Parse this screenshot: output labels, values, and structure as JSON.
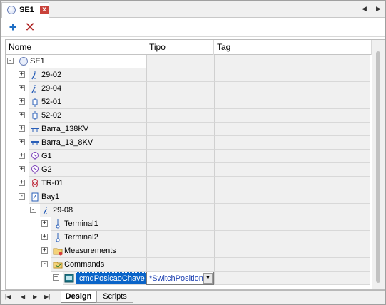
{
  "window": {
    "tab_title": "SE1",
    "close_glyph": "x",
    "nav_left": "◀",
    "nav_right": "▶"
  },
  "toolbar": {
    "add_glyph": "+",
    "delete_glyph": "✕"
  },
  "grid": {
    "columns": [
      "Nome",
      "Tipo",
      "Tag"
    ],
    "rows": [
      {
        "label": "SE1",
        "level": 0,
        "expander": "-",
        "icon": "substation-circle-icon"
      },
      {
        "label": "29-02",
        "level": 1,
        "expander": "+",
        "icon": "disconnector-icon"
      },
      {
        "label": "29-04",
        "level": 1,
        "expander": "+",
        "icon": "disconnector-icon"
      },
      {
        "label": "52-01",
        "level": 1,
        "expander": "+",
        "icon": "breaker-icon"
      },
      {
        "label": "52-02",
        "level": 1,
        "expander": "+",
        "icon": "breaker-icon"
      },
      {
        "label": "Barra_138KV",
        "level": 1,
        "expander": "+",
        "icon": "busbar-icon"
      },
      {
        "label": "Barra_13_8KV",
        "level": 1,
        "expander": "+",
        "icon": "busbar-icon"
      },
      {
        "label": "G1",
        "level": 1,
        "expander": "+",
        "icon": "generator-icon"
      },
      {
        "label": "G2",
        "level": 1,
        "expander": "+",
        "icon": "generator-icon"
      },
      {
        "label": "TR-01",
        "level": 1,
        "expander": "+",
        "icon": "transformer-icon"
      },
      {
        "label": "Bay1",
        "level": 1,
        "expander": "-",
        "icon": "bay-icon"
      },
      {
        "label": "29-08",
        "level": 2,
        "expander": "-",
        "icon": "disconnector-icon"
      },
      {
        "label": "Terminal1",
        "level": 3,
        "expander": "+",
        "icon": "terminal-icon"
      },
      {
        "label": "Terminal2",
        "level": 3,
        "expander": "+",
        "icon": "terminal-icon"
      },
      {
        "label": "Measurements",
        "level": 3,
        "expander": "+",
        "icon": "measurements-folder-icon"
      },
      {
        "label": "Commands",
        "level": 3,
        "expander": "-",
        "icon": "commands-folder-icon"
      },
      {
        "label": "cmdPosicaoChave",
        "level": 4,
        "expander": "+",
        "icon": "command-item-icon",
        "selected": true,
        "tipo": "*SwitchPosition"
      }
    ]
  },
  "bottom_tabs": {
    "design": "Design",
    "scripts": "Scripts"
  },
  "bottom_nav": {
    "first": "|◀",
    "prev": "◀",
    "next": "▶",
    "last": "▶|"
  },
  "colors": {
    "selection": "#0a64c8",
    "tipo_value": "#1c3fb0",
    "add": "#1f6fc5",
    "delete": "#b02828"
  }
}
